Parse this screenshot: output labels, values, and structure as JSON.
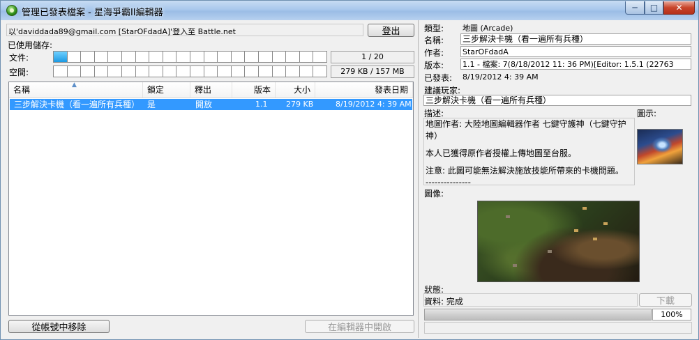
{
  "window": {
    "title": "管理已發表檔案 - 星海爭霸II編輯器"
  },
  "account": {
    "login_text": "以'daviddada89@gmail.com [StarOFdadA]'登入至 Battle.net",
    "logout_label": "登出"
  },
  "storage": {
    "title": "已使用儲存:",
    "files_label": "文件:",
    "files_value": "1 / 20",
    "files_fraction": 0.05,
    "space_label": "空間:",
    "space_value": "279 KB / 157 MB",
    "space_fraction": 0.0017
  },
  "table": {
    "columns": [
      "名稱",
      "鎖定",
      "釋出",
      "版本",
      "大小",
      "發表日期"
    ],
    "rows": [
      {
        "name": "三步解決卡機（看一遍所有兵種）",
        "locked": "是",
        "release": "開放",
        "version": "1.1",
        "size": "279 KB",
        "date": "8/19/2012 4: 39 AM"
      }
    ]
  },
  "buttons": {
    "remove_label": "從帳號中移除",
    "open_editor_label": "在編輯器中開啟",
    "download_label": "下載"
  },
  "details": {
    "type_label": "類型:",
    "type_value": "地圖 (Arcade)",
    "name_label": "名稱:",
    "name_value": "三步解決卡機（看一遍所有兵種）",
    "author_label": "作者:",
    "author_value": "StarOFdadA",
    "version_label": "版本:",
    "version_value": "1.1 - 檔案: 7(8/18/2012 11: 36 PM)[Editor: 1.5.1 (22763",
    "published_label": "已發表:",
    "published_value": "8/19/2012 4: 39 AM",
    "players_label": "建議玩家:",
    "players_value": "三步解決卡機（看一遍所有兵種）",
    "desc_label": "描述:",
    "desc_lines": [
      "地圖作者: 大陸地圖編輯器作者 七鍵守護神（七鍵守护神）",
      "本人已獲得原作者授權上傳地圖至台服。",
      "注意: 此圖可能無法解決施放技能所帶來的卡機問題。",
      "---------------"
    ],
    "icon_label": "圖示:",
    "image_label": "圖像:",
    "status_label": "狀態:",
    "data_label": "資料: 完成",
    "progress_percent": "100%",
    "progress_fraction": 1.0
  }
}
